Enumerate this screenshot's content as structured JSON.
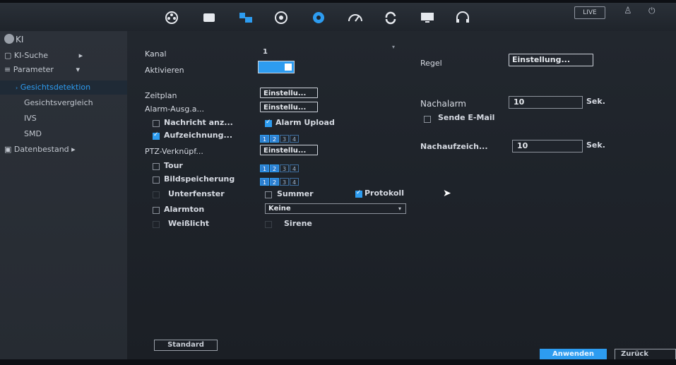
{
  "topbar": {
    "icons": [
      "camera-reel-icon",
      "playback-icon",
      "network-icon",
      "storage-icon",
      "settings-icon",
      "performance-icon",
      "sync-icon",
      "monitor-icon",
      "headset-icon"
    ],
    "live_label": "LIVE"
  },
  "sidebar": {
    "header": "KI",
    "items": [
      {
        "label": "KI-Suche",
        "arrow": "▸"
      },
      {
        "label": "Parameter",
        "arrow": "▾"
      },
      {
        "label": "Gesichtsdetektion"
      },
      {
        "label": "Gesichtsvergleich"
      },
      {
        "label": "IVS"
      },
      {
        "label": "SMD"
      },
      {
        "label": "Datenbestand",
        "arrow": "▸"
      }
    ]
  },
  "form": {
    "kanal_label": "Kanal",
    "kanal_value": "1",
    "aktivieren_label": "Aktivieren",
    "regel_label": "Regel",
    "regel_button": "Einstellung...",
    "zeitplan_label": "Zeitplan",
    "zeitplan_button": "Einstellu...",
    "alarm_ausg_label": "Alarm-Ausg.a...",
    "alarm_ausg_button": "Einstellu...",
    "nachricht_label": "Nachricht anz...",
    "alarm_upload_label": "Alarm Upload",
    "aufzeichnung_label": "Aufzeichnung...",
    "ptz_label": "PTZ-Verknüpf...",
    "ptz_button": "Einstellu...",
    "tour_label": "Tour",
    "bildspeicherung_label": "Bildspeicherung",
    "unterfenster_label": "Unterfenster",
    "summer_label": "Summer",
    "protokoll_label": "Protokoll",
    "alarmton_label": "Alarmton",
    "alarmton_value": "Keine",
    "weisslicht_label": "Weißlicht",
    "sirene_label": "Sirene",
    "nachalarm_label": "Nachalarm",
    "nachalarm_value": "10",
    "nachalarm_unit": "Sek.",
    "sende_email_label": "Sende E-Mail",
    "nachaufzeich_label": "Nachaufzeich...",
    "nachaufzeich_value": "10",
    "nachaufzeich_unit": "Sek.",
    "channel_numbers": [
      "1",
      "2",
      "3",
      "4"
    ]
  },
  "footer": {
    "standard_button": "Standard",
    "apply_button": "Anwenden",
    "back_button": "Zurück"
  },
  "colors": {
    "accent": "#2d9cf0",
    "background": "#1f242b",
    "sidebar": "#2a2f36"
  }
}
